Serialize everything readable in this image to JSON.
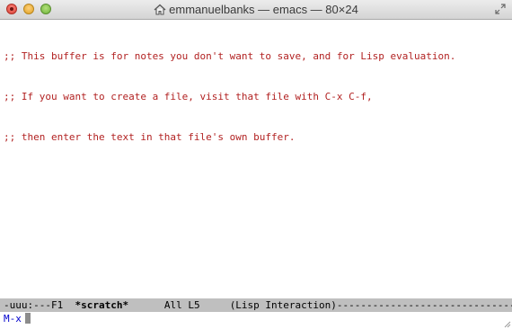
{
  "window": {
    "title": "emmanuelbanks — emacs — 80×24"
  },
  "buffer": {
    "lines": [
      ";; This buffer is for notes you don't want to save, and for Lisp evaluation.",
      ";; If you want to create a file, visit that file with C-x C-f,",
      ";; then enter the text in that file's own buffer."
    ]
  },
  "modeline": {
    "status": "-uuu:---F1  ",
    "buffer_name": "*scratch*",
    "position": "      All L5     ",
    "mode": "(Lisp Interaction)",
    "trailing": "------------------------------------------"
  },
  "minibuffer": {
    "prompt": "M-x"
  },
  "colors": {
    "comment": "#b22222",
    "minibuffer_prompt": "#0000cd",
    "modeline_bg": "#bfbfbf"
  },
  "icons": {
    "title_icon": "home-icon",
    "fullscreen": "fullscreen-icon",
    "resize": "resize-grip-icon"
  }
}
